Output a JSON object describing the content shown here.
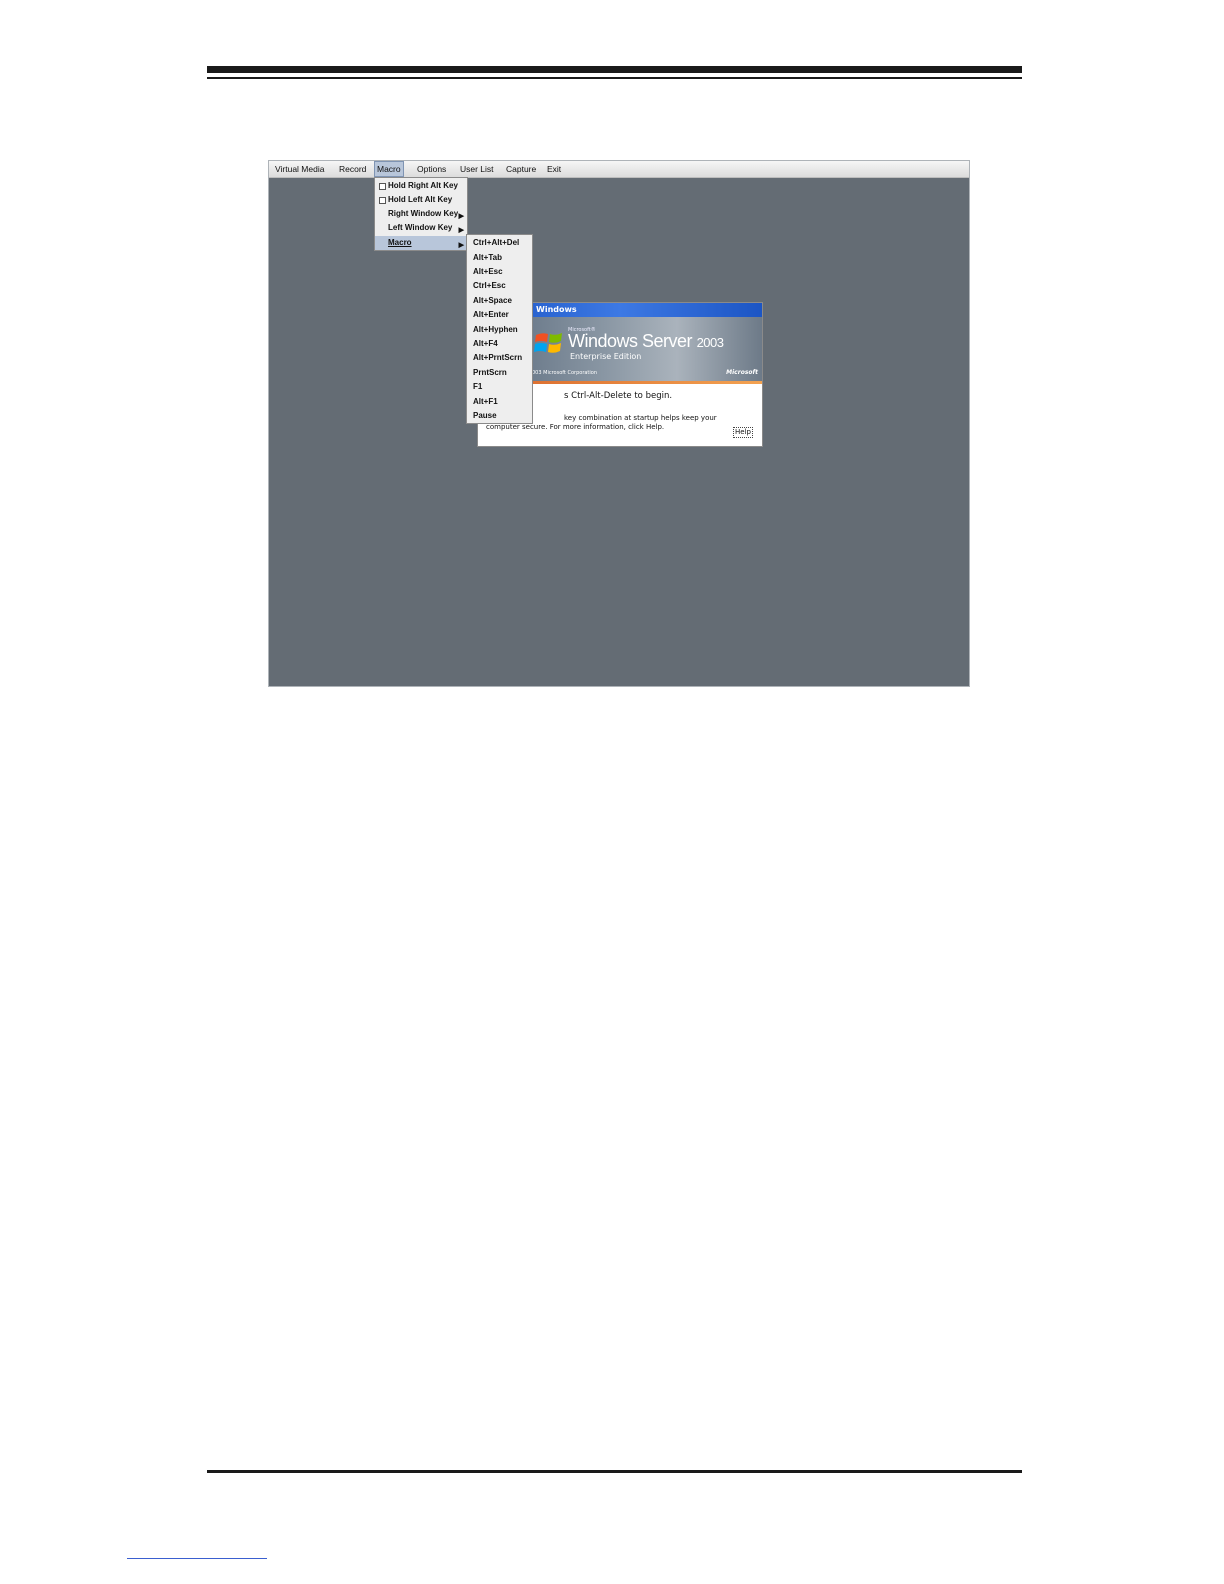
{
  "menubar": {
    "items": [
      "Virtual Media",
      "Record",
      "Macro",
      "Options",
      "User List",
      "Capture",
      "Exit"
    ],
    "active_index": 2
  },
  "macro_menu": {
    "items": [
      {
        "label": "Hold Right Alt Key",
        "checkbox": true,
        "submenu": false
      },
      {
        "label": "Hold Left Alt Key",
        "checkbox": true,
        "submenu": false
      },
      {
        "label": "Right Window Key",
        "checkbox": false,
        "submenu": true
      },
      {
        "label": "Left Window Key",
        "checkbox": false,
        "submenu": true
      },
      {
        "label": "Macro",
        "checkbox": false,
        "submenu": true,
        "selected": true
      }
    ]
  },
  "macro_submenu": {
    "items": [
      "Ctrl+Alt+Del",
      "Alt+Tab",
      "Alt+Esc",
      "Ctrl+Esc",
      "Alt+Space",
      "Alt+Enter",
      "Alt+Hyphen",
      "Alt+F4",
      "Alt+PrntScrn",
      "PrntScrn",
      "F1",
      "Alt+F1",
      "Pause"
    ]
  },
  "dialog": {
    "title": "Windows",
    "ms_small": "Microsoft®",
    "product_name": "Windows Server",
    "product_year": "2003",
    "edition": "Enterprise Edition",
    "copyright": "003  Microsoft Corporation",
    "brand": "Microsoft",
    "line1": "s Ctrl-Alt-Delete to begin.",
    "line2": "key combination at startup helps keep your",
    "line3": "computer secure. For more information, click Help.",
    "help_label": "Help"
  },
  "colors": {
    "desktop": "#646c74",
    "menu_highlight": "#b8c6da",
    "title_blue": "#1c55c4",
    "stripe_orange": "#d8662a"
  }
}
